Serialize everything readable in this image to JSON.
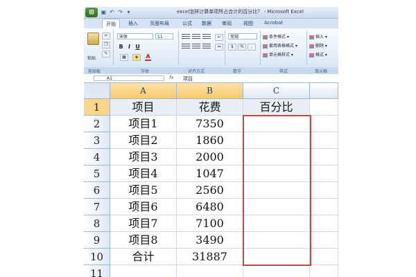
{
  "window": {
    "title": "excel怎样计算单项所占合计的百分比？ - Microsoft Excel",
    "app_logo": "excel-logo-icon"
  },
  "ribbon_tabs": [
    {
      "label": "开始",
      "active": true
    },
    {
      "label": "插入",
      "active": false
    },
    {
      "label": "页面布局",
      "active": false
    },
    {
      "label": "公式",
      "active": false
    },
    {
      "label": "数据",
      "active": false
    },
    {
      "label": "审阅",
      "active": false
    },
    {
      "label": "视图",
      "active": false
    },
    {
      "label": "Acrobat",
      "active": false
    }
  ],
  "ribbon": {
    "paste_label": "粘贴",
    "font_name": "宋体",
    "font_size": "11",
    "number_format": "常规",
    "bold": "B",
    "italic": "I",
    "underline": "U",
    "font_color_letter": "A",
    "cond_format": "条件格式 ▾",
    "table_format": "套用表格格式 ▾",
    "cell_style": "单元格样式 ▾",
    "insert": "插入 ▾",
    "delete": "删除 ▾",
    "format": "格式 ▾",
    "groups": {
      "clipboard": "剪贴板",
      "font": "字体",
      "alignment": "对齐方式",
      "number": "数字",
      "styles": "样式",
      "cells": "单元格"
    }
  },
  "formula_bar": {
    "name_box": "A1",
    "fx": "fx",
    "value": "项目"
  },
  "sheet": {
    "columns": [
      "A",
      "B",
      "C"
    ],
    "rows": [
      {
        "n": "1",
        "a": "项目",
        "b": "花费",
        "c": "百分比"
      },
      {
        "n": "2",
        "a": "项目1",
        "b": "7350",
        "c": ""
      },
      {
        "n": "3",
        "a": "项目2",
        "b": "1860",
        "c": ""
      },
      {
        "n": "4",
        "a": "项目3",
        "b": "2000",
        "c": ""
      },
      {
        "n": "5",
        "a": "项目4",
        "b": "1047",
        "c": ""
      },
      {
        "n": "6",
        "a": "项目5",
        "b": "2560",
        "c": ""
      },
      {
        "n": "7",
        "a": "项目6",
        "b": "6480",
        "c": ""
      },
      {
        "n": "8",
        "a": "项目7",
        "b": "7100",
        "c": ""
      },
      {
        "n": "9",
        "a": "项目8",
        "b": "3490",
        "c": ""
      },
      {
        "n": "10",
        "a": "合计",
        "b": "31887",
        "c": ""
      },
      {
        "n": "11",
        "a": "",
        "b": "",
        "c": ""
      }
    ]
  },
  "colors": {
    "selection_border": "#b94a4a",
    "header_fill": "#e9edf4",
    "selected_row_header": "#fbd58a"
  }
}
